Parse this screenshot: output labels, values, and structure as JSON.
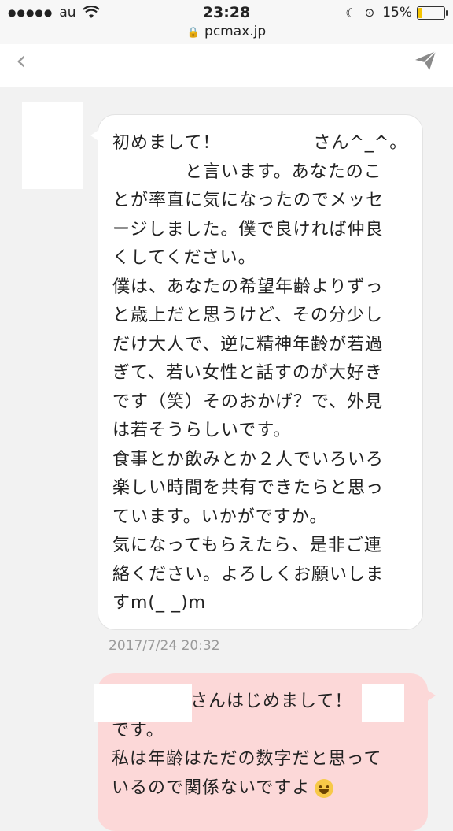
{
  "status_bar": {
    "signal": "●●●●●",
    "carrier": "au",
    "time": "23:28",
    "battery_text": "15%",
    "battery_level": 0.15,
    "battery_color": "#f5c400"
  },
  "url_bar": {
    "url": "pcmax.jp",
    "lock_icon": "lock-icon"
  },
  "header": {
    "back_icon": "chevron-left-icon",
    "send_icon": "paper-plane-icon"
  },
  "incoming": {
    "lines": [
      "初めまして！",
      "さん^_^。",
      "と言います。あなたのこ",
      "とが率直に気になったのでメッセ",
      "ージしました。僕で良ければ仲良",
      "くしてください。",
      "僕は、あなたの希望年齢よりずっ",
      "と歳上だと思うけど、その分少し",
      "だけ大人で、逆に精神年齢が若過",
      "ぎて、若い女性と話すのが大好き",
      "です（笑）そのおかげ？で、外見",
      "は若そうらしいです。",
      "食事とか飲みとか２人でいろいろ",
      "楽しい時間を共有できたらと思っ",
      "ています。いかがですか。",
      "気になってもらえたら、是非ご連",
      "絡ください。よろしくお願いしま",
      "すm(_ _)m"
    ],
    "timestamp": "2017/7/24 20:32"
  },
  "outgoing": {
    "lines": [
      "さんはじめまして！",
      "です。",
      "私は年齢はただの数字だと思って",
      "いるので関係ないですよ"
    ],
    "bubble_color": "#fcd8d8",
    "emoji": "grinning-face-icon"
  }
}
